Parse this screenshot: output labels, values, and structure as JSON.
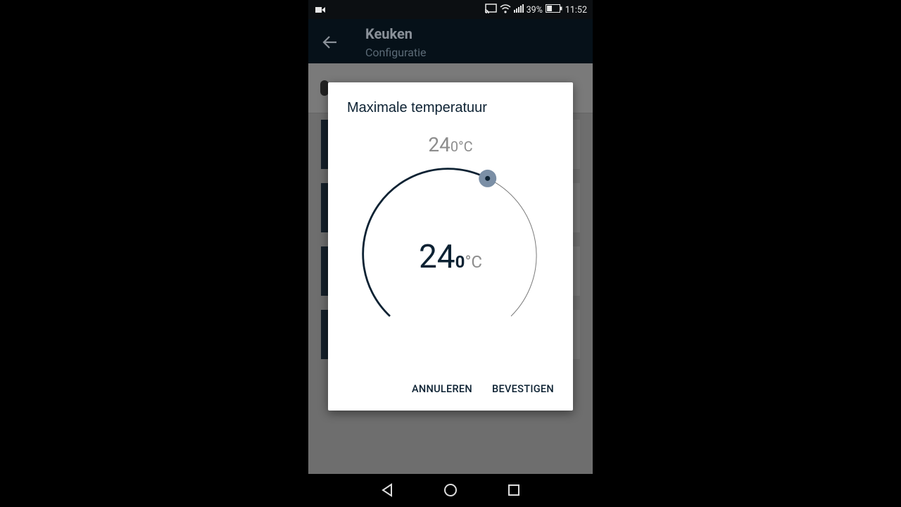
{
  "status_bar": {
    "battery_percent": "39%",
    "time": "11:52",
    "icons": [
      "video-camera-icon",
      "cast-icon",
      "wifi-icon",
      "signal-icon",
      "battery-icon"
    ]
  },
  "app_bar": {
    "title": "Keuken",
    "subtitle": "Configuratie",
    "back_icon": "arrow-back-icon"
  },
  "dialog": {
    "title": "Maximale temperatuur",
    "preview": {
      "integer": "24",
      "decimal": "0",
      "unit": "°C"
    },
    "dial": {
      "integer": "24",
      "decimal": "0",
      "unit": "°C",
      "value": 24.0
    },
    "buttons": {
      "cancel": "ANNULEREN",
      "confirm": "BEVESTIGEN"
    }
  },
  "colors": {
    "accent": "#0d2233",
    "appbar": "#061119",
    "knob": "#7b8fa6"
  },
  "nav_bar": {
    "icons": [
      "back-triangle-icon",
      "home-circle-icon",
      "recents-square-icon"
    ]
  }
}
